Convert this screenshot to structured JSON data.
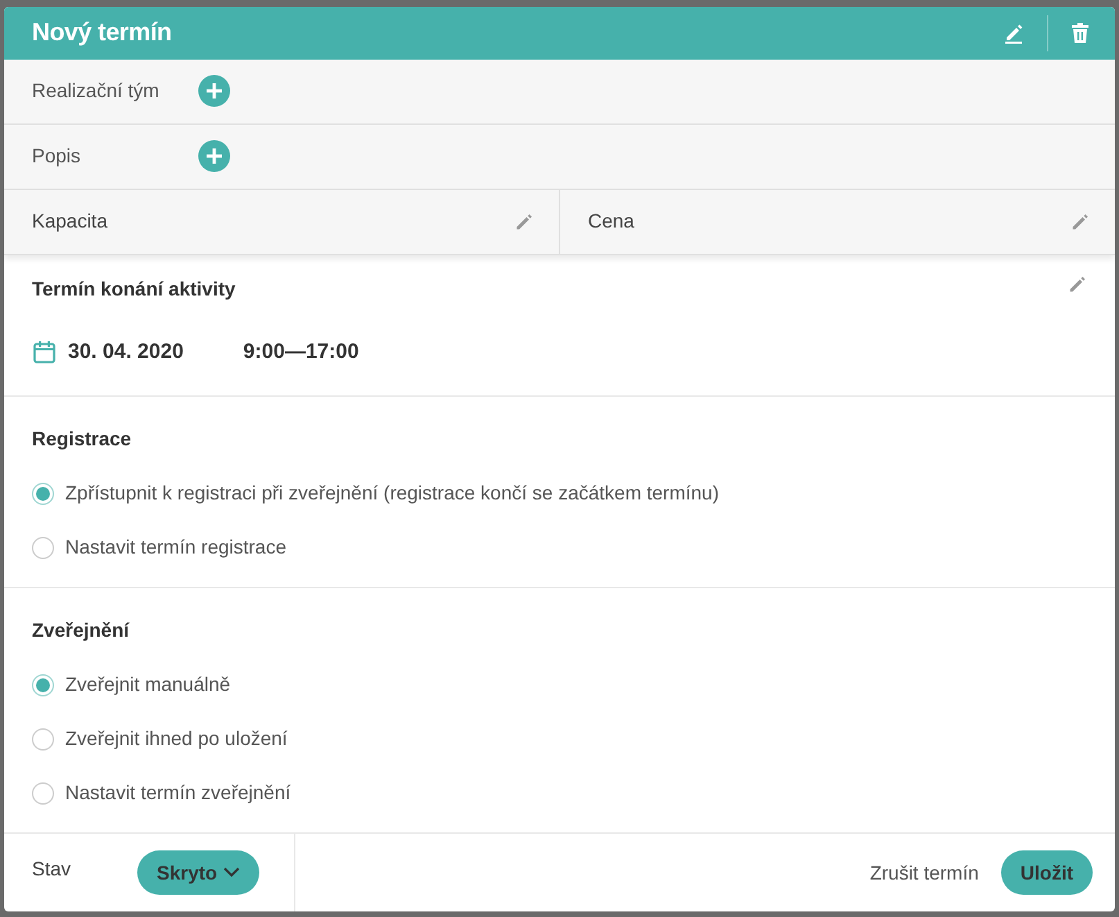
{
  "dialog": {
    "title": "Nový termín"
  },
  "fields": [
    {
      "kind": "add",
      "label": "Realizační tým"
    },
    {
      "kind": "add",
      "label": "Popis"
    }
  ],
  "split_fields": [
    {
      "label": "Kapacita"
    },
    {
      "label": "Cena"
    }
  ],
  "schedule": {
    "heading": "Termín konání aktivity",
    "date": "30. 04. 2020",
    "time": "9:00—17:00"
  },
  "groups": [
    {
      "heading": "Registrace",
      "options": [
        {
          "label": "Zpřístupnit k registraci při zveřejnění (registrace končí se začátkem termínu)",
          "selected": true
        },
        {
          "label": "Nastavit termín registrace",
          "selected": false
        }
      ]
    },
    {
      "heading": "Zveřejnění",
      "options": [
        {
          "label": "Zveřejnit manuálně",
          "selected": true
        },
        {
          "label": "Zveřejnit ihned po uložení",
          "selected": false
        },
        {
          "label": "Nastavit termín zveřejnění",
          "selected": false
        }
      ]
    }
  ],
  "footer": {
    "status_label": "Stav",
    "status_value": "Skryto",
    "cancel": "Zrušit termín",
    "save": "Uložit"
  }
}
